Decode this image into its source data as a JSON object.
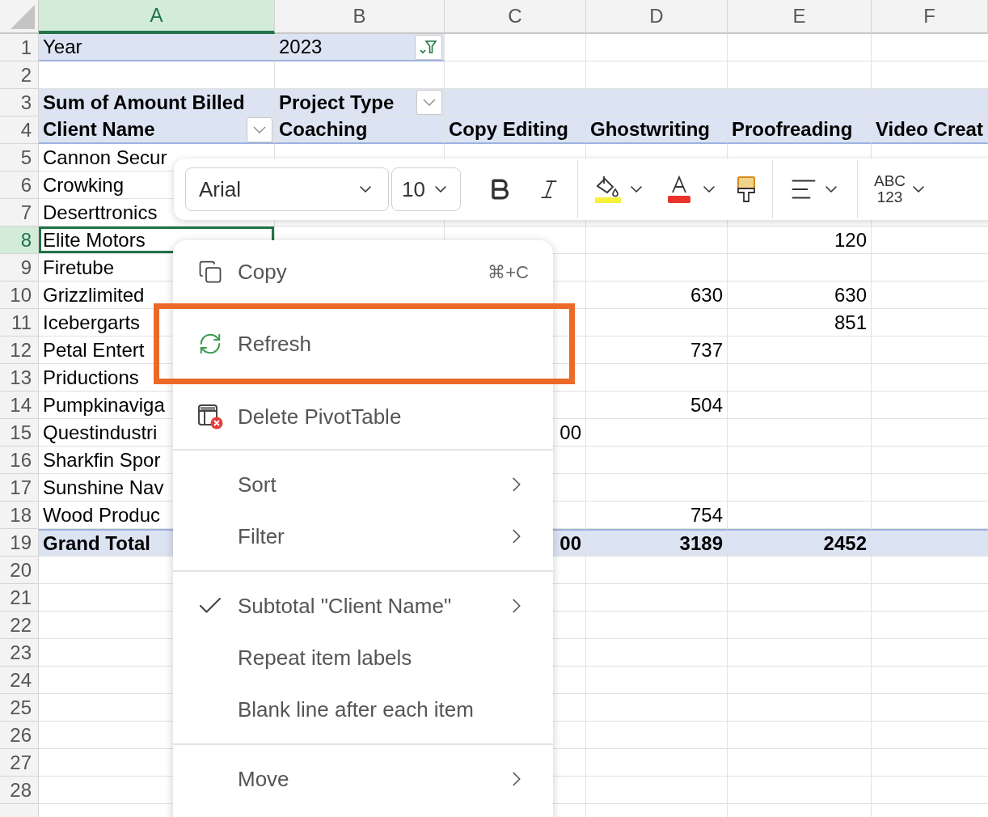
{
  "column_headers": [
    {
      "label": "A",
      "selected": true
    },
    {
      "label": "B",
      "selected": false
    },
    {
      "label": "C",
      "selected": false
    },
    {
      "label": "D",
      "selected": false
    },
    {
      "label": "E",
      "selected": false
    },
    {
      "label": "F",
      "selected": false
    }
  ],
  "rows": [
    {
      "number": "1",
      "kind": "page_filter",
      "selected": false,
      "cells": {
        "A": {
          "text": "Year"
        },
        "B": {
          "text": "2023",
          "filter_button": true
        }
      }
    },
    {
      "number": "2",
      "kind": "blank",
      "selected": false,
      "cells": {}
    },
    {
      "number": "3",
      "kind": "header_top",
      "selected": false,
      "cells": {
        "A": {
          "text": "Sum of Amount Billed"
        },
        "B": {
          "text": "Project Type",
          "dropdown_button": true
        }
      }
    },
    {
      "number": "4",
      "kind": "header",
      "selected": false,
      "cells": {
        "A": {
          "text": "Client Name",
          "dropdown_button": true
        },
        "B": {
          "text": "Coaching"
        },
        "C": {
          "text": "Copy Editing"
        },
        "D": {
          "text": "Ghostwriting"
        },
        "E": {
          "text": "Proofreading"
        },
        "F": {
          "text": "Video Creat"
        }
      }
    },
    {
      "number": "5",
      "kind": "data",
      "selected": false,
      "cells": {
        "A": {
          "text": "Cannon Secur"
        }
      }
    },
    {
      "number": "6",
      "kind": "data",
      "selected": false,
      "cells": {
        "A": {
          "text": "Crowking"
        }
      }
    },
    {
      "number": "7",
      "kind": "data",
      "selected": false,
      "cells": {
        "A": {
          "text": "Deserttronics"
        }
      }
    },
    {
      "number": "8",
      "kind": "data",
      "selected": true,
      "cells": {
        "A": {
          "text": "Elite Motors"
        },
        "E": {
          "text": "120"
        }
      }
    },
    {
      "number": "9",
      "kind": "data",
      "selected": false,
      "cells": {
        "A": {
          "text": "Firetube"
        }
      }
    },
    {
      "number": "10",
      "kind": "data",
      "selected": false,
      "cells": {
        "A": {
          "text": "Grizzlimited"
        },
        "D": {
          "text": "630"
        },
        "E": {
          "text": "630"
        }
      }
    },
    {
      "number": "11",
      "kind": "data",
      "selected": false,
      "cells": {
        "A": {
          "text": "Icebergarts"
        },
        "E": {
          "text": "851"
        }
      }
    },
    {
      "number": "12",
      "kind": "data",
      "selected": false,
      "cells": {
        "A": {
          "text": "Petal Entert"
        },
        "D": {
          "text": "737"
        }
      }
    },
    {
      "number": "13",
      "kind": "data",
      "selected": false,
      "cells": {
        "A": {
          "text": "Priductions"
        }
      }
    },
    {
      "number": "14",
      "kind": "data",
      "selected": false,
      "cells": {
        "A": {
          "text": "Pumpkinaviga"
        },
        "D": {
          "text": "504"
        }
      }
    },
    {
      "number": "15",
      "kind": "data",
      "selected": false,
      "cells": {
        "A": {
          "text": "Questindustri"
        },
        "C": {
          "text": "00"
        }
      }
    },
    {
      "number": "16",
      "kind": "data",
      "selected": false,
      "cells": {
        "A": {
          "text": "Sharkfin Spor"
        }
      }
    },
    {
      "number": "17",
      "kind": "data",
      "selected": false,
      "cells": {
        "A": {
          "text": "Sunshine Nav"
        }
      }
    },
    {
      "number": "18",
      "kind": "data",
      "selected": false,
      "cells": {
        "A": {
          "text": "Wood Produc"
        },
        "D": {
          "text": "754"
        }
      }
    },
    {
      "number": "19",
      "kind": "total",
      "selected": false,
      "cells": {
        "A": {
          "text": "Grand Total"
        },
        "C": {
          "text": "00"
        },
        "D": {
          "text": "3189"
        },
        "E": {
          "text": "2452"
        }
      }
    },
    {
      "number": "20",
      "kind": "blank",
      "selected": false,
      "cells": {}
    },
    {
      "number": "21",
      "kind": "blank",
      "selected": false,
      "cells": {}
    },
    {
      "number": "22",
      "kind": "blank",
      "selected": false,
      "cells": {}
    },
    {
      "number": "23",
      "kind": "blank",
      "selected": false,
      "cells": {}
    },
    {
      "number": "24",
      "kind": "blank",
      "selected": false,
      "cells": {}
    },
    {
      "number": "25",
      "kind": "blank",
      "selected": false,
      "cells": {}
    },
    {
      "number": "26",
      "kind": "blank",
      "selected": false,
      "cells": {}
    },
    {
      "number": "27",
      "kind": "blank",
      "selected": false,
      "cells": {}
    },
    {
      "number": "28",
      "kind": "blank",
      "selected": false,
      "cells": {}
    }
  ],
  "toolbar": {
    "font": "Arial",
    "size": "10",
    "number_format": [
      "ABC",
      "123"
    ]
  },
  "menu": {
    "groups": [
      [
        {
          "label": "Copy",
          "kind": "copy",
          "shortcut": "⌘+C",
          "submenu": false,
          "highlighted": false
        },
        {
          "label": "Refresh",
          "kind": "refresh",
          "submenu": false,
          "highlighted": true
        },
        {
          "label": "Delete PivotTable",
          "kind": "delete",
          "submenu": false,
          "highlighted": false
        }
      ],
      [
        {
          "label": "Sort",
          "kind": "plain",
          "submenu": true,
          "highlighted": false
        },
        {
          "label": "Filter",
          "kind": "plain",
          "submenu": true,
          "highlighted": false
        }
      ],
      [
        {
          "label": "Subtotal \"Client Name\"",
          "kind": "toggle",
          "checked": true,
          "submenu": true,
          "highlighted": false
        },
        {
          "label": "Repeat item labels",
          "kind": "toggle",
          "checked": false,
          "submenu": false,
          "highlighted": false
        },
        {
          "label": "Blank line after each item",
          "kind": "toggle",
          "checked": false,
          "submenu": false,
          "highlighted": false
        }
      ],
      [
        {
          "label": "Move",
          "kind": "plain",
          "submenu": true,
          "highlighted": false
        }
      ]
    ]
  }
}
